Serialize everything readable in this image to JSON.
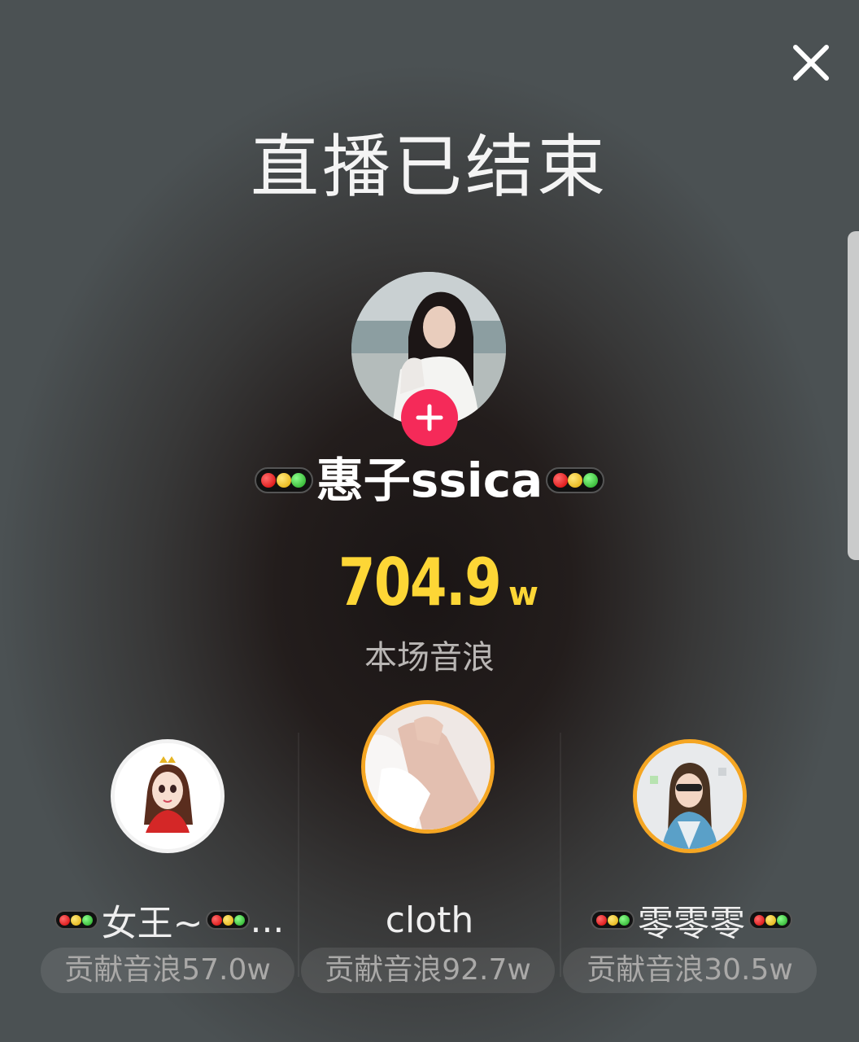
{
  "title": "直播已结束",
  "close_icon": "close-icon",
  "host": {
    "name": "惠子ssica",
    "follow_icon": "plus-icon"
  },
  "stats": {
    "value": "704.9",
    "unit": "w",
    "label": "本场音浪",
    "value_color": "#fdd636"
  },
  "follow_button_color": "#f52a59",
  "contributors": [
    {
      "name": "女王~",
      "suffix": "...",
      "contribution": "贡献音浪57.0w",
      "border_color": "#f2f2f2"
    },
    {
      "name": "cloth",
      "suffix": "",
      "contribution": "贡献音浪92.7w",
      "border_color": "#f5a623"
    },
    {
      "name": "零零零",
      "suffix": "",
      "contribution": "贡献音浪30.5w",
      "border_color": "#f5a623"
    }
  ]
}
